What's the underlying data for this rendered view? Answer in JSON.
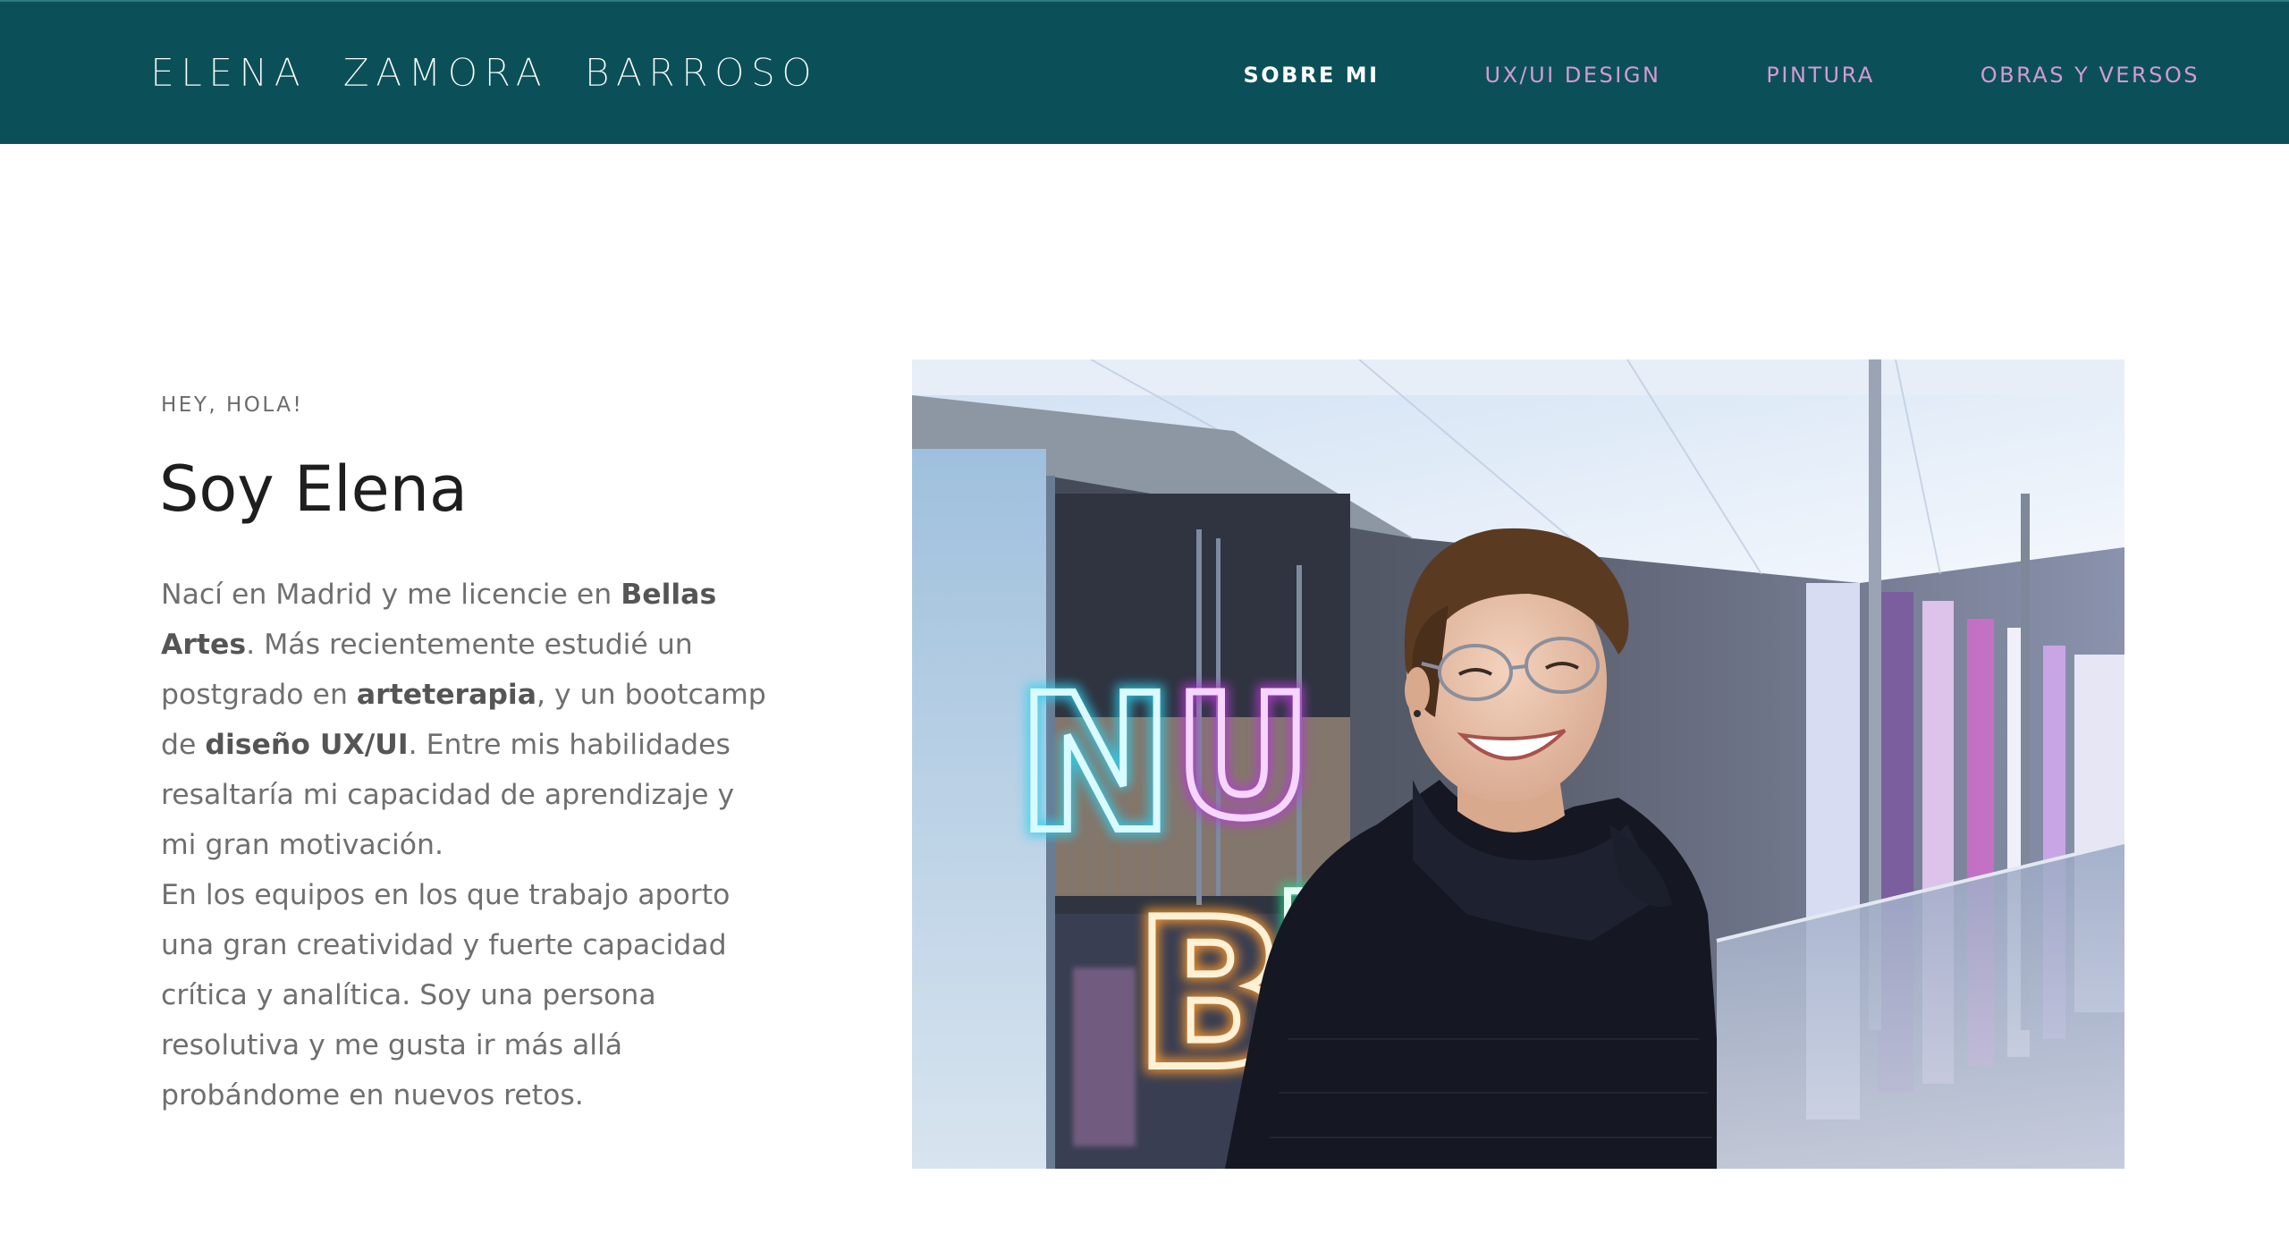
{
  "header": {
    "logo": "ELENA ZAMORA BARROSO",
    "nav": [
      {
        "label": "SOBRE MI",
        "active": true
      },
      {
        "label": "UX/UI DESIGN",
        "active": false
      },
      {
        "label": "PINTURA",
        "active": false
      },
      {
        "label": "OBRAS Y VERSOS",
        "active": false
      }
    ]
  },
  "intro": {
    "eyebrow": "HEY, HOLA!",
    "title": "Soy Elena",
    "bio": {
      "p1_a": "Nací en Madrid y me licencie en ",
      "p1_b": "Bellas Artes",
      "p1_c": ". Más recientemente estudié un postgrado en ",
      "p1_d": "arteterapia",
      "p1_e": ", y un bootcamp de ",
      "p1_f": "diseño UX/UI",
      "p1_g": ". Entre mis habilidades resaltaría mi capacidad de aprendizaje y mi gran motivación.",
      "p2": "En los equipos en los que trabajo aporto una gran creatividad y fuerte capacidad crítica y analítica. Soy una persona resolutiva y me gusta ir más allá probándome en nuevos retos."
    }
  },
  "photo": {
    "neon_letters": [
      "N",
      "U",
      "B",
      "E"
    ]
  },
  "colors": {
    "header_bg": "#0b5059",
    "nav_link": "#d59ad2",
    "nav_active": "#ffffff",
    "text": "#6f6f6f"
  }
}
